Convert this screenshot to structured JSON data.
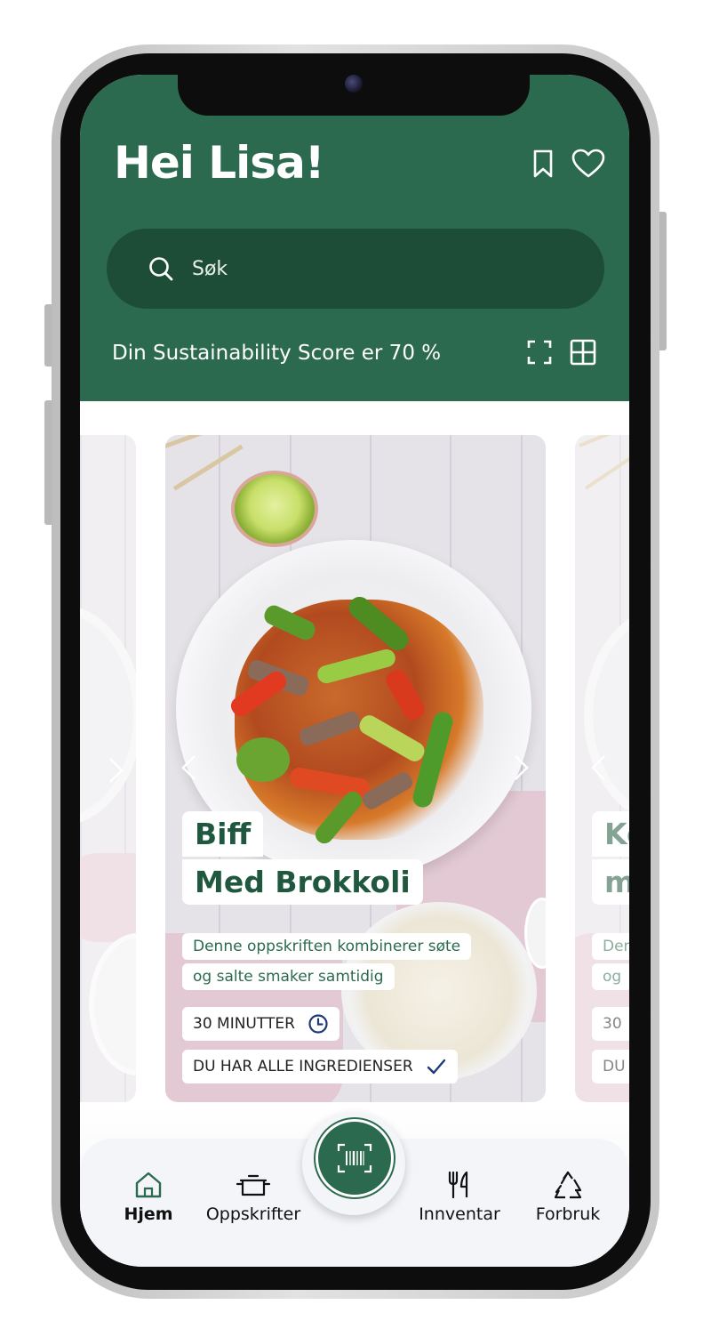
{
  "header": {
    "greeting": "Hei Lisa!",
    "search_placeholder": "Søk",
    "score_text": "Din Sustainability Score er 70 %"
  },
  "icons": {
    "bookmark": "bookmark-icon",
    "favorite": "heart-icon",
    "search": "search-icon",
    "expand": "expand-icon",
    "grid": "grid-icon",
    "clock": "clock-icon",
    "check": "check-icon",
    "scan": "barcode-scan-icon"
  },
  "cards": {
    "current": {
      "title_line1": "Biff",
      "title_line2": "Med Brokkoli",
      "desc_line1": "Denne oppskriften kombinerer søte",
      "desc_line2": "og salte smaker samtidig",
      "time": "30 MINUTTER",
      "ingredients": "DU HAR ALLE INGREDIENSER"
    },
    "next": {
      "title_line1": "Ko",
      "title_line2": "m",
      "desc_line1": "Den",
      "desc_line2": "og",
      "time": "30",
      "ingredients": "DU"
    }
  },
  "nav": {
    "items": [
      {
        "label": "Hjem",
        "active": true
      },
      {
        "label": "Oppskrifter",
        "active": false
      },
      {
        "label": "Innventar",
        "active": false
      },
      {
        "label": "Forbruk",
        "active": false
      }
    ]
  },
  "colors": {
    "brand_green": "#2b6a4e",
    "search_bg": "#1d4c37",
    "text_green": "#20583f",
    "nav_bg": "#f4f5f9"
  }
}
